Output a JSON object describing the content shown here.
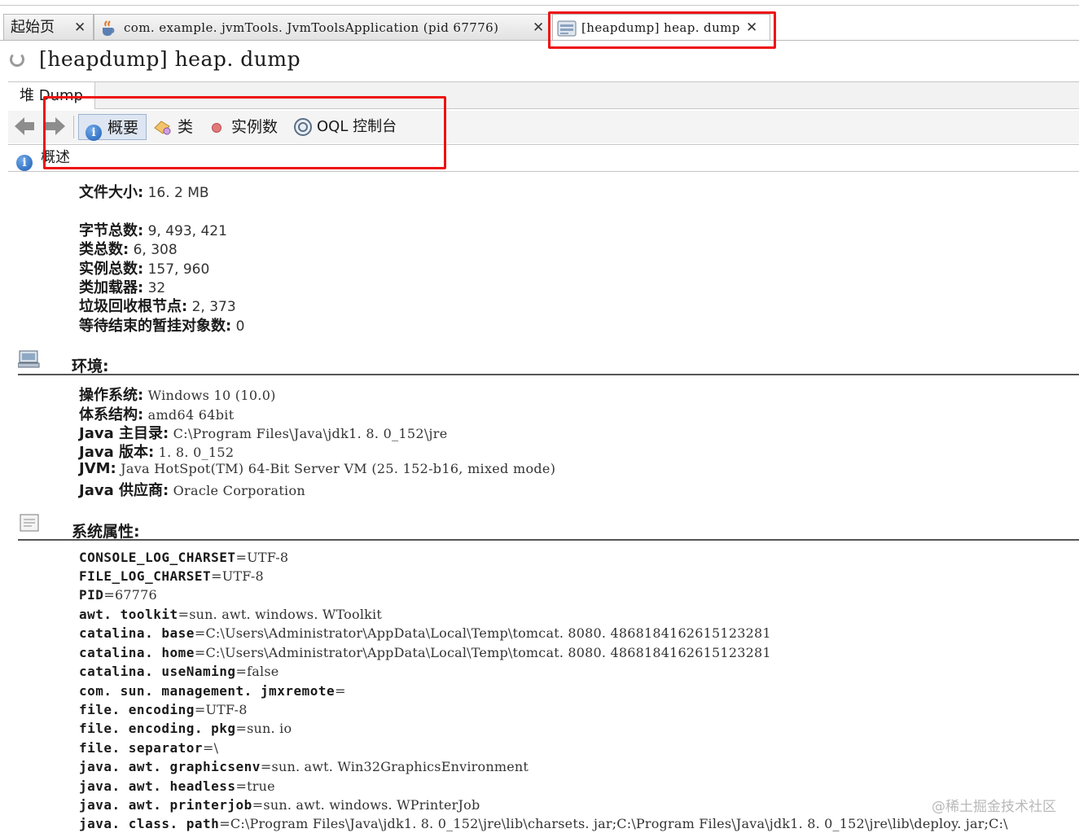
{
  "tabs": [
    {
      "label": "起始页",
      "close": "✕",
      "icon": "home"
    },
    {
      "label": "com. example. jvmTools. JvmToolsApplication (pid 67776)",
      "close": "✕",
      "icon": "java-cup-icon"
    },
    {
      "label": "[heapdump] heap. dump",
      "close": "✕",
      "icon": "heapdump-icon",
      "active": true
    }
  ],
  "title": "[heapdump]  heap. dump",
  "subtab": {
    "label": "堆 Dump"
  },
  "toolbar": {
    "back_icon": "arrow-left-icon",
    "forward_icon": "arrow-right-icon",
    "summary": "概要",
    "classes": "类",
    "instances": "实例数",
    "oql": "OQL 控制台"
  },
  "nav": {
    "label": "概述"
  },
  "basic": [
    {
      "key": "文件大小",
      "value": "16. 2 MB"
    },
    {
      "key": "字节总数",
      "value": "9, 493, 421"
    },
    {
      "key": "类总数",
      "value": "6, 308"
    },
    {
      "key": "实例总数",
      "value": "157, 960"
    },
    {
      "key": "类加载器",
      "value": "32"
    },
    {
      "key": "垃圾回收根节点",
      "value": "2, 373"
    },
    {
      "key": "等待结束的暂挂对象数",
      "value": "0"
    }
  ],
  "env": {
    "title": "环境:",
    "icon": "computer-icon",
    "rows": [
      {
        "key": "操作系统",
        "value": "Windows 10 (10.0)"
      },
      {
        "key": "体系结构",
        "value": "amd64 64bit"
      },
      {
        "key": "Java 主目录",
        "value": "C:\\Program Files\\Java\\jdk1. 8. 0_152\\jre"
      },
      {
        "key": "Java 版本",
        "value": "1. 8. 0_152"
      },
      {
        "key": "JVM",
        "value": "Java HotSpot(TM) 64-Bit Server VM (25. 152-b16, mixed mode)"
      },
      {
        "key": "Java 供应商",
        "value": "Oracle Corporation"
      }
    ]
  },
  "props": {
    "title": "系统属性:",
    "icon": "document-icon",
    "rows": [
      {
        "key": "CONSOLE_LOG_CHARSET",
        "value": "=UTF-8"
      },
      {
        "key": "FILE_LOG_CHARSET",
        "value": "=UTF-8"
      },
      {
        "key": "PID",
        "value": "=67776"
      },
      {
        "key": "awt. toolkit",
        "value": "=sun. awt. windows. WToolkit"
      },
      {
        "key": "catalina. base",
        "value": "=C:\\Users\\Administrator\\AppData\\Local\\Temp\\tomcat. 8080. 4868184162615123281"
      },
      {
        "key": "catalina. home",
        "value": "=C:\\Users\\Administrator\\AppData\\Local\\Temp\\tomcat. 8080. 4868184162615123281"
      },
      {
        "key": "catalina. useNaming",
        "value": "=false"
      },
      {
        "key": "com. sun. management. jmxremote",
        "value": "="
      },
      {
        "key": "file. encoding",
        "value": "=UTF-8"
      },
      {
        "key": "file. encoding. pkg",
        "value": "=sun. io"
      },
      {
        "key": "file. separator",
        "value": "=\\"
      },
      {
        "key": "java. awt. graphicsenv",
        "value": "=sun. awt. Win32GraphicsEnvironment"
      },
      {
        "key": "java. awt. headless",
        "value": "=true"
      },
      {
        "key": "java. awt. printerjob",
        "value": "=sun. awt. windows. WPrinterJob"
      },
      {
        "key": "java. class. path",
        "value": "=C:\\Program Files\\Java\\jdk1. 8. 0_152\\jre\\lib\\charsets. jar;C:\\Program Files\\Java\\jdk1. 8. 0_152\\jre\\lib\\deploy. jar;C:\\"
      }
    ]
  },
  "watermark": "@稀土掘金技术社区",
  "colors": {
    "highlight": "#ee1111",
    "info_blue": "#1f5fb6"
  }
}
